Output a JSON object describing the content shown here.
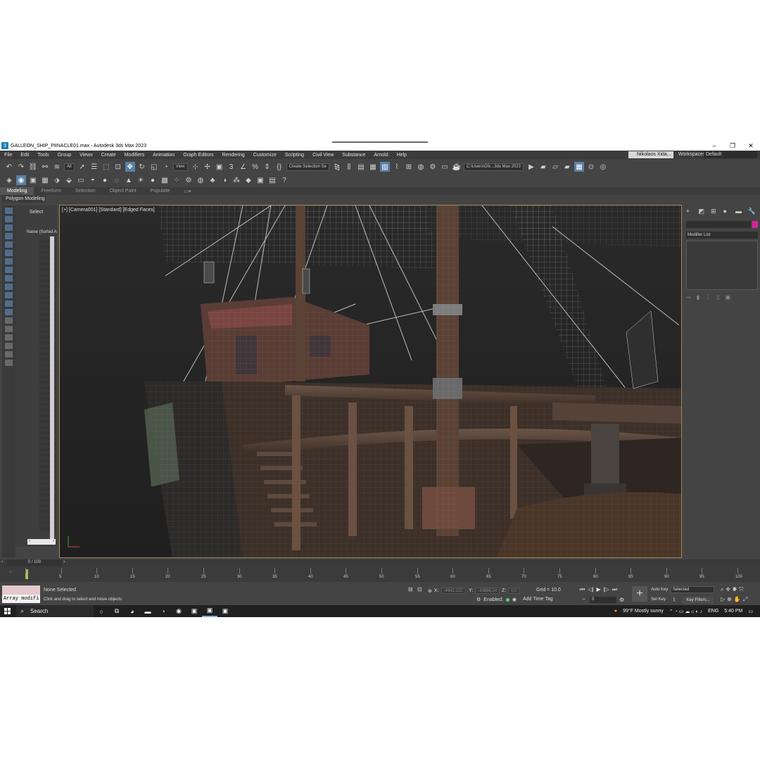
{
  "window": {
    "title": "GALLEON_SHIP_PIINACLE01.max - Autodesk 3ds Max 2023",
    "controls": [
      "–",
      "❐",
      "✕"
    ]
  },
  "menu": {
    "items": [
      "File",
      "Edit",
      "Tools",
      "Group",
      "Views",
      "Create",
      "Modifiers",
      "Animation",
      "Graph Editors",
      "Rendering",
      "Customize",
      "Scripting",
      "Civil View",
      "Substance",
      "Arnold",
      "Help"
    ],
    "user": "Nikolaos Xida...",
    "workspaces_label": "Workspaces:",
    "workspace": "Default"
  },
  "toolbar": {
    "selection_filter": "All",
    "ref_coord": "View",
    "named_selection": "Create Selection Se",
    "project_path": "C:\\Users\\Gfx...3ds Max 2023"
  },
  "ribbon": {
    "tabs": [
      "Modeling",
      "Freeform",
      "Selection",
      "Object Paint",
      "Populate"
    ],
    "panel": "Polygon Modeling"
  },
  "scene_explorer": {
    "select_label": "Select",
    "column_header": "Name (Sorted A"
  },
  "viewport": {
    "label": "[+] [Camera001] [Standard] [Edged Faces]"
  },
  "command_panel": {
    "modifier_list": "Modifier List"
  },
  "timeline": {
    "frame_counter": "0 / 100",
    "ticks": [
      "0",
      "5",
      "10",
      "15",
      "20",
      "25",
      "30",
      "35",
      "40",
      "45",
      "50",
      "55",
      "60",
      "65",
      "70",
      "75",
      "80",
      "85",
      "90",
      "95",
      "100"
    ]
  },
  "status": {
    "script_text": "Array modifi",
    "selection": "None Selected",
    "prompt": "Click and drag to select and move objects",
    "x_label": "X:",
    "x_value": "-4942.222",
    "y_label": "Y:",
    "y_value": "-43686.24",
    "z_label": "Z:",
    "z_value": "0.0",
    "grid": "Grid = 10.0",
    "enabled_label": "Enabled:",
    "add_time_tag": "Add Time Tag",
    "auto_key": "Auto Key",
    "set_key": "Set Key",
    "key_mode": "Selected",
    "key_filters": "Key Filters...",
    "current_frame": "0"
  },
  "taskbar": {
    "search": "Search",
    "weather": "99°F  Mostly sunny",
    "language": "ENG",
    "time": "5:40 PM"
  },
  "colors": {
    "app_bg": "#444444",
    "viewport_bg": "#2b2b2b",
    "accent": "#5a7fa8",
    "swatch": "#d8259a"
  }
}
